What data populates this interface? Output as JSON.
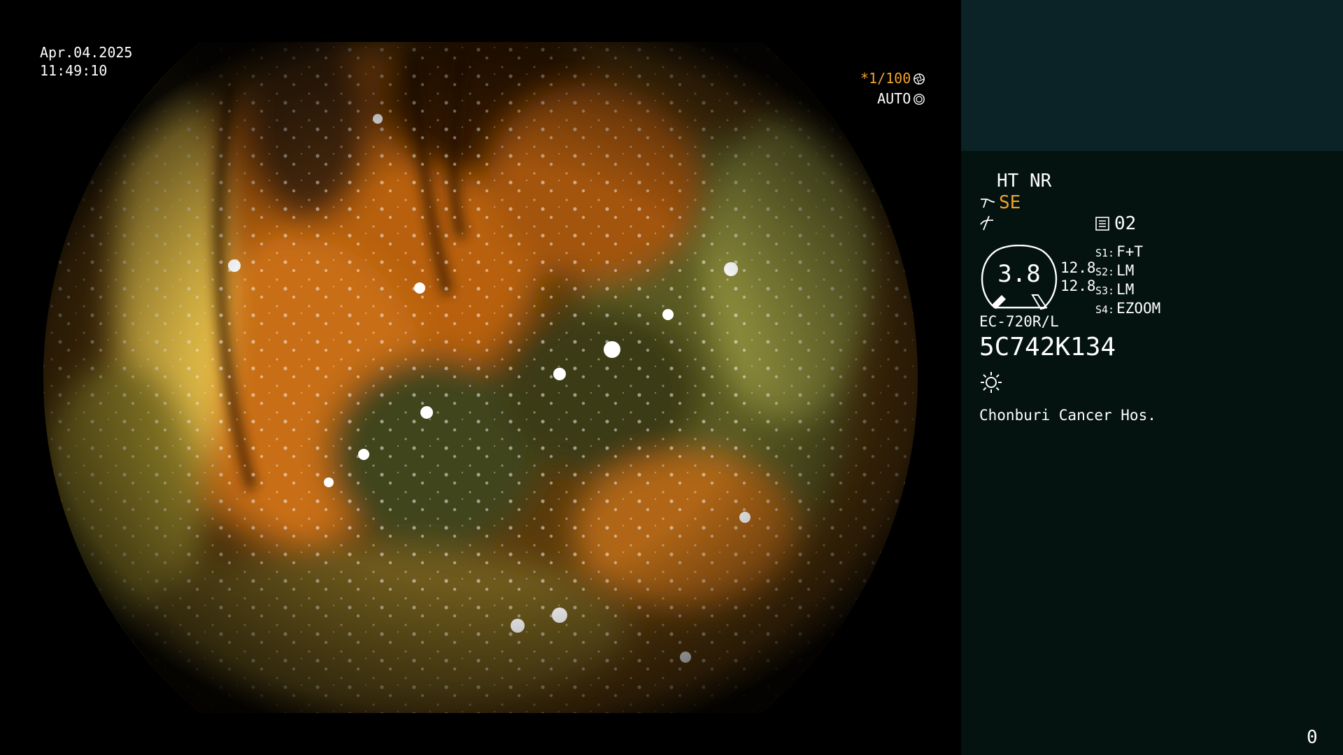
{
  "overlay": {
    "date": "Apr.04.2025",
    "time": "11:49:10",
    "shutter_speed": "*1/100",
    "iris_mode": "AUTO"
  },
  "panel": {
    "ht_nr": "HT NR",
    "se": "SE",
    "memory_label": "02",
    "gauge_value": "3.8",
    "value_1": "12.8",
    "value_2": "12.8",
    "presets": [
      {
        "key": "S1:",
        "value": "F+T"
      },
      {
        "key": "S2:",
        "value": "LM"
      },
      {
        "key": "S3:",
        "value": "LM"
      },
      {
        "key": "S4:",
        "value": "EZOOM"
      }
    ],
    "scope_model": "EC-720R/L",
    "serial": "5C742K134",
    "hospital": "Chonburi Cancer Hos.",
    "counter": "0"
  },
  "colors": {
    "accent_orange": "#f2a22a",
    "panel_top": "#0b2326",
    "panel_bg": "#041210"
  },
  "icons": [
    "aperture-icon",
    "iris-icon",
    "structure-enhance-icon",
    "white-balance-icon",
    "memo-icon",
    "sun-icon"
  ]
}
